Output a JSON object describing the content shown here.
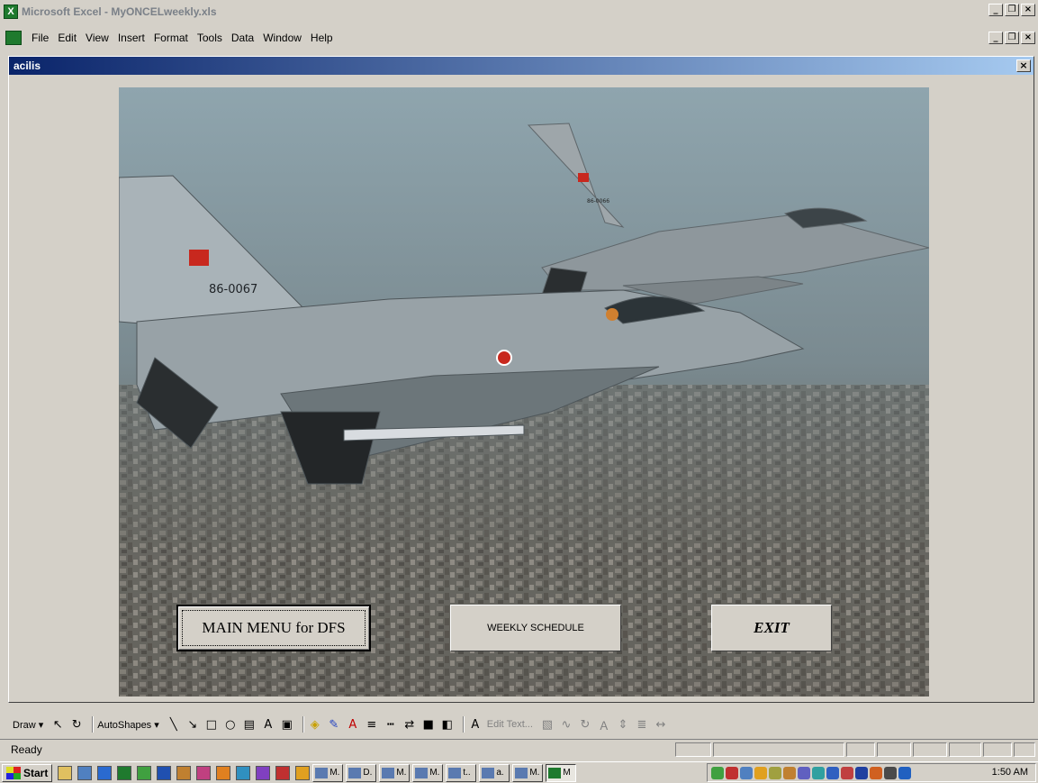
{
  "app": {
    "title": "Microsoft Excel - MyONCELweekly.xls"
  },
  "menu": {
    "items": [
      {
        "label": "File"
      },
      {
        "label": "Edit"
      },
      {
        "label": "View"
      },
      {
        "label": "Insert"
      },
      {
        "label": "Format"
      },
      {
        "label": "Tools"
      },
      {
        "label": "Data"
      },
      {
        "label": "Window"
      },
      {
        "label": "Help"
      }
    ]
  },
  "form": {
    "title": "acilis",
    "close_glyph": "×",
    "photo": {
      "lead_jet_tail": "86-0067",
      "second_jet_tail": "86-0066"
    },
    "buttons": {
      "main_menu": "MAIN MENU for DFS",
      "weekly": "WEEKLY SCHEDULE",
      "exit": "EXIT"
    }
  },
  "drawing_toolbar": {
    "draw": "Draw ▾",
    "autoshapes": "AutoShapes ▾",
    "edit_text": "Edit Text..."
  },
  "status": {
    "text": "Ready"
  },
  "taskbar": {
    "start": "Start",
    "tasks": [
      "M.",
      "D.",
      "M.",
      "M.",
      "t..",
      "a.",
      "M.",
      "M"
    ],
    "clock": "1:50 AM"
  },
  "colors": {
    "title_gradient_start": "#0a246a",
    "title_gradient_end": "#a6caf0",
    "face": "#d4d0c8"
  },
  "icons": [
    "excel-icon",
    "close-icon",
    "minimize-icon",
    "restore-icon",
    "start-flag-icon"
  ]
}
